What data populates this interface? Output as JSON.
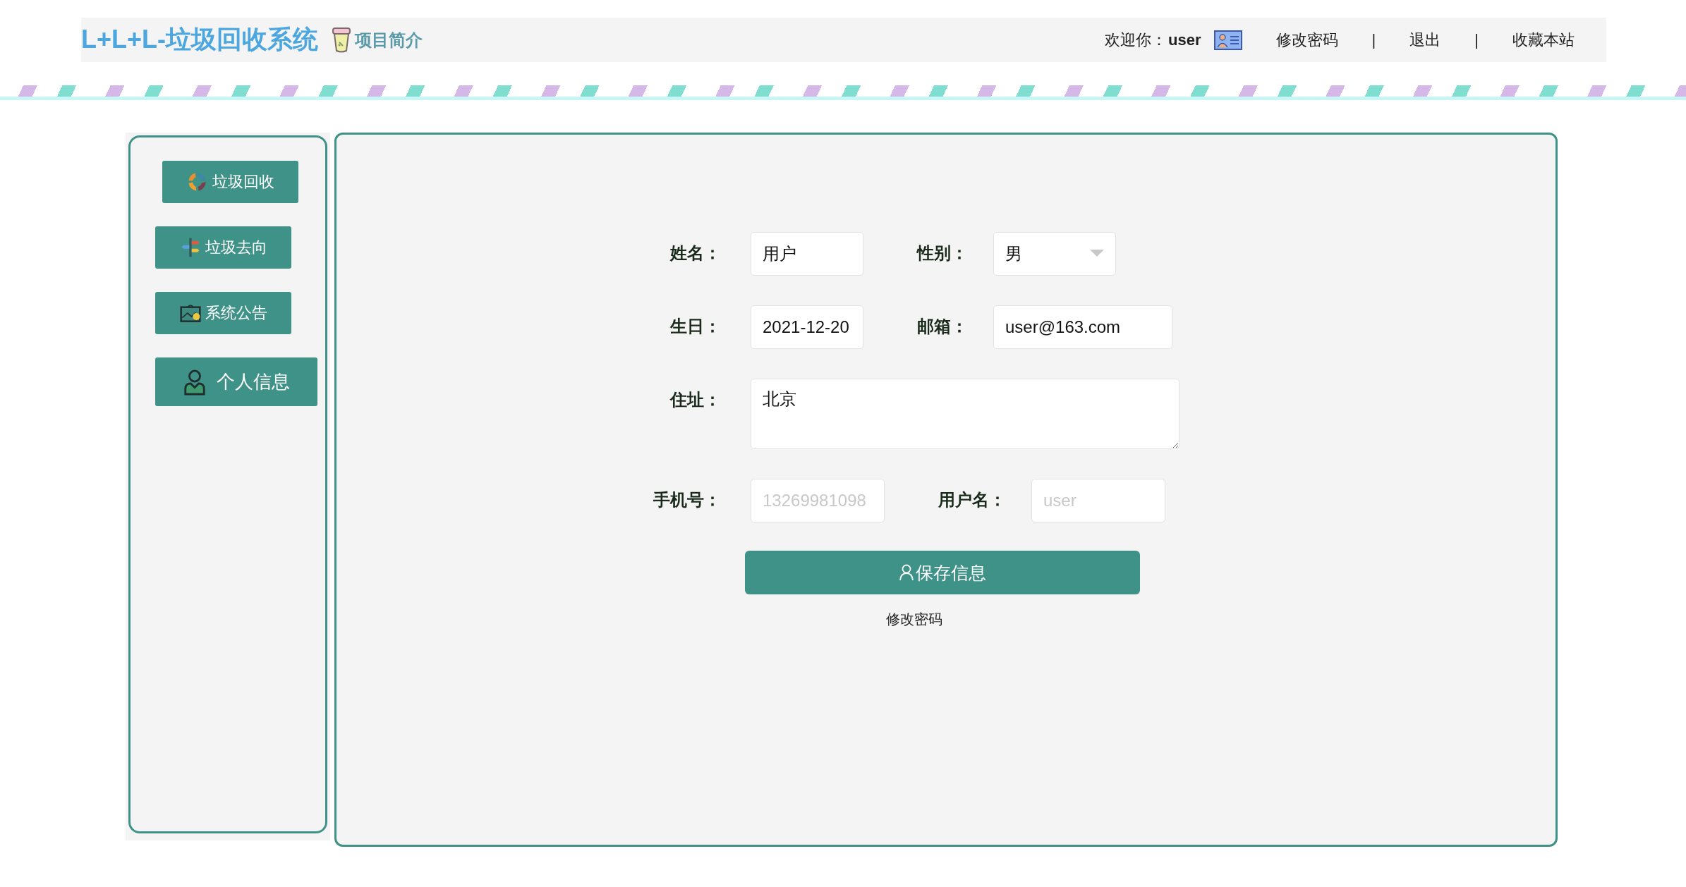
{
  "header": {
    "title": "L+L+L-垃圾回收系统",
    "intro_link": "项目简介",
    "welcome_label": "欢迎你：",
    "username": "user",
    "nav": [
      {
        "kind": "link",
        "label": "修改密码"
      },
      {
        "kind": "separator",
        "label": "|"
      },
      {
        "kind": "link",
        "label": "退出"
      },
      {
        "kind": "separator",
        "label": "|"
      },
      {
        "kind": "link",
        "label": "收藏本站"
      }
    ]
  },
  "sidebar": {
    "items": [
      {
        "label": "垃圾回收",
        "selected": false
      },
      {
        "label": "垃圾去向",
        "selected": false
      },
      {
        "label": "系统公告",
        "selected": false
      },
      {
        "label": "个人信息",
        "selected": true
      }
    ]
  },
  "form": {
    "rows": [
      {
        "fields": [
          {
            "kind": "text",
            "label": "姓名：",
            "value": "用户"
          },
          {
            "kind": "select",
            "label": "性别：",
            "value": "男"
          }
        ]
      },
      {
        "fields": [
          {
            "kind": "text",
            "label": "生日：",
            "value": "2021-12-20"
          },
          {
            "kind": "email",
            "label": "邮箱：",
            "value": "user@163.com"
          }
        ]
      },
      {
        "fields": [
          {
            "kind": "textarea",
            "label": "住址：",
            "value": "北京"
          }
        ]
      },
      {
        "fields": [
          {
            "kind": "phone",
            "label": "手机号：",
            "placeholder": "13269981098"
          },
          {
            "kind": "username",
            "label": "用户名：",
            "placeholder": "user"
          }
        ]
      }
    ],
    "save_button": "保存信息",
    "change_password_link": "修改密码"
  }
}
